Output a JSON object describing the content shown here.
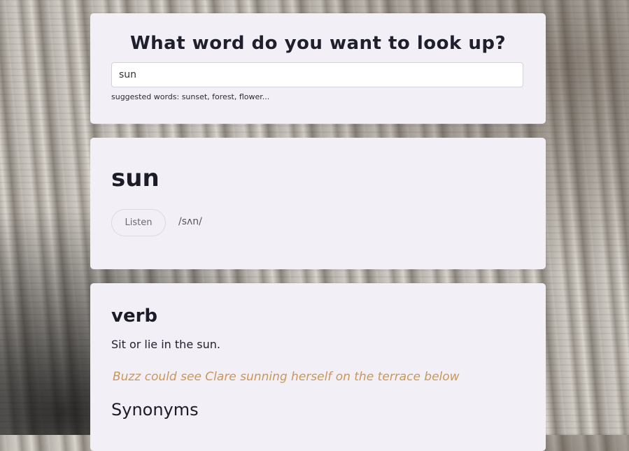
{
  "search": {
    "title": "What word do you want to look up?",
    "value": "sun",
    "suggestion": "suggested words: sunset, forest, flower..."
  },
  "word": {
    "title": "sun",
    "listen_label": "Listen",
    "phonetic": "/sʌn/"
  },
  "meaning": {
    "part_of_speech": "verb",
    "definition": "Sit or lie in the sun.",
    "example": "Buzz could see Clare sunning herself on the terrace below",
    "synonyms_title": "Synonyms"
  },
  "colors": {
    "card_background": "#f2eff6",
    "example_text": "#c99759",
    "heading_text": "#1c1c28"
  }
}
